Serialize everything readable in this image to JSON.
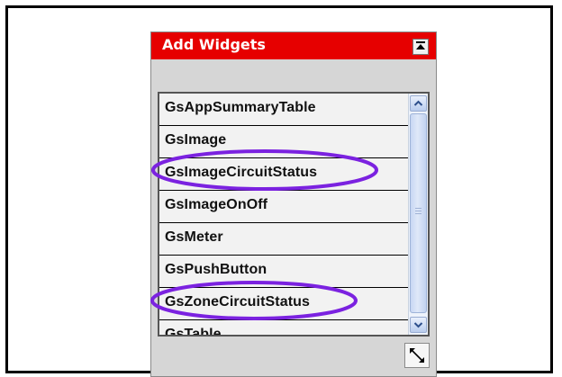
{
  "panel": {
    "title": "Add Widgets",
    "title_bg_color": "#e60000",
    "collapse_icon": "collapse-up-icon",
    "resize_icon": "resize-diagonal-icon"
  },
  "widget_list": {
    "items": [
      {
        "label": "GsAppSummaryTable"
      },
      {
        "label": "GsImage"
      },
      {
        "label": "GsImageCircuitStatus",
        "highlighted": true
      },
      {
        "label": "GsImageOnOff"
      },
      {
        "label": "GsMeter"
      },
      {
        "label": "GsPushButton"
      },
      {
        "label": "GsZoneCircuitStatus",
        "highlighted": true
      },
      {
        "label": "GsTable"
      }
    ],
    "highlight_color": "#7b22e0"
  }
}
